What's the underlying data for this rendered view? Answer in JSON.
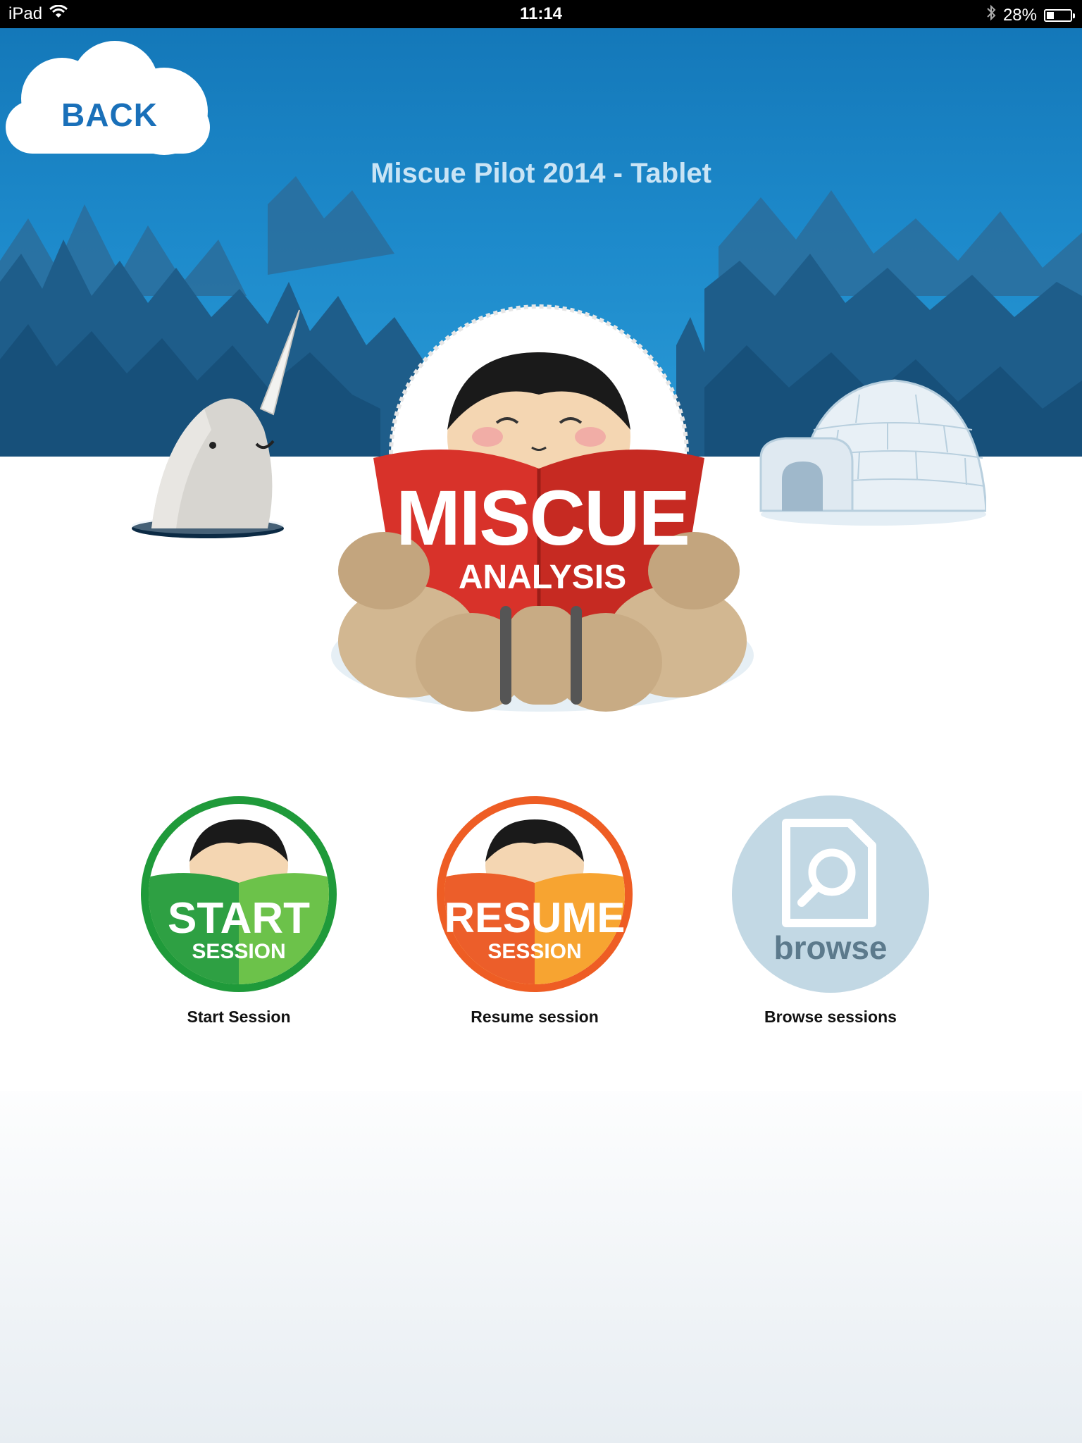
{
  "status_bar": {
    "device": "iPad",
    "time": "11:14",
    "battery": "28%",
    "battery_level": 0.28
  },
  "back_button": {
    "label": "BACK"
  },
  "title": "Miscue Pilot 2014 - Tablet",
  "logo": {
    "line1": "MISCUE",
    "line2": "ANALYSIS"
  },
  "actions": [
    {
      "badge_main": "START",
      "badge_sub": "SESSION",
      "label": "Start Session",
      "color": "#1f9a3a"
    },
    {
      "badge_main": "RESUME",
      "badge_sub": "SESSION",
      "label": "Resume session",
      "color": "#ee5d24"
    },
    {
      "badge_main": "browse",
      "label": "Browse sessions",
      "color": "#c2d8e4"
    }
  ],
  "icons": [
    "wifi-icon",
    "bluetooth-icon",
    "battery-icon",
    "document-search-icon"
  ]
}
